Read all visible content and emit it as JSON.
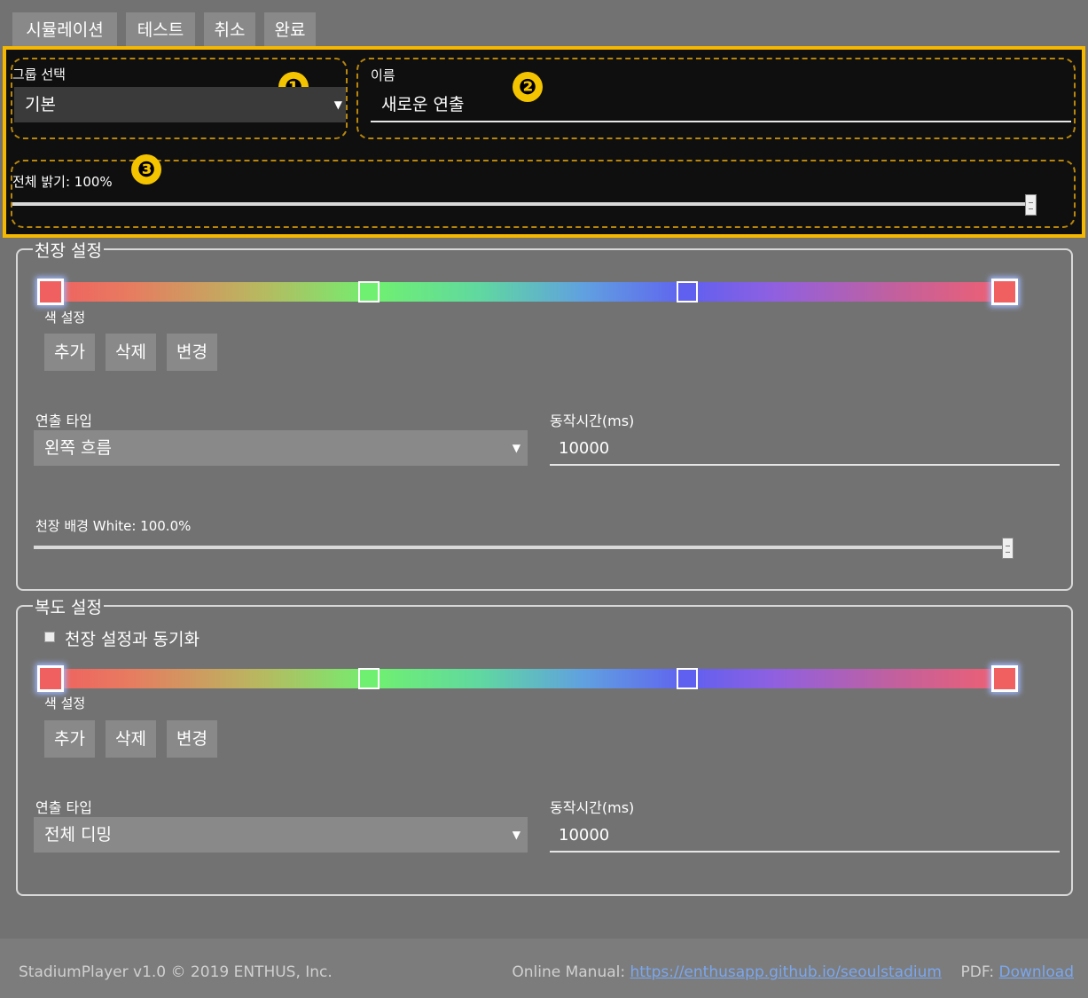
{
  "toolbar": {
    "simulation": "시뮬레이션",
    "test": "테스트",
    "cancel": "취소",
    "done": "완료"
  },
  "badges": [
    "❶",
    "❷",
    "❸"
  ],
  "group_select": {
    "label": "그룹 선택",
    "value": "기본"
  },
  "name_field": {
    "label": "이름",
    "value": "새로운 연출"
  },
  "brightness": {
    "label": "전체 밝기: 100%",
    "level": 1.0
  },
  "ceiling": {
    "title": "천장 설정",
    "color_label": "색 설정",
    "add": "추가",
    "delete": "삭제",
    "change": "변경",
    "type_label": "연출 타입",
    "type_value": "왼쪽 흐름",
    "duration_label": "동작시간(ms)",
    "duration_value": "10000",
    "bg_label": "천장 배경 White: 100.0%",
    "bg_level": 1.0,
    "stop_colors": [
      "#f06060",
      "#70f070",
      "#6060f0",
      "#f06060"
    ]
  },
  "corridor": {
    "title": "복도 설정",
    "sync_label": "천장 설정과 동기화",
    "color_label": "색 설정",
    "add": "추가",
    "delete": "삭제",
    "change": "변경",
    "type_label": "연출 타입",
    "type_value": "전체 디밍",
    "duration_label": "동작시간(ms)",
    "duration_value": "10000",
    "stop_colors": [
      "#f06060",
      "#70f070",
      "#6060f0",
      "#f06060"
    ]
  },
  "footer": {
    "copyright": "StadiumPlayer v1.0 © 2019 ENTHUS, Inc.",
    "manual_label": "Online Manual:",
    "manual_link": "https://enthusapp.github.io/seoulstadium",
    "pdf_label": "PDF:",
    "pdf_link": "Download"
  },
  "colors": {
    "accent": "#f5b800",
    "panel_bg": "#0f0f0f",
    "page_bg": "#727272",
    "link": "#7aa7ef"
  }
}
